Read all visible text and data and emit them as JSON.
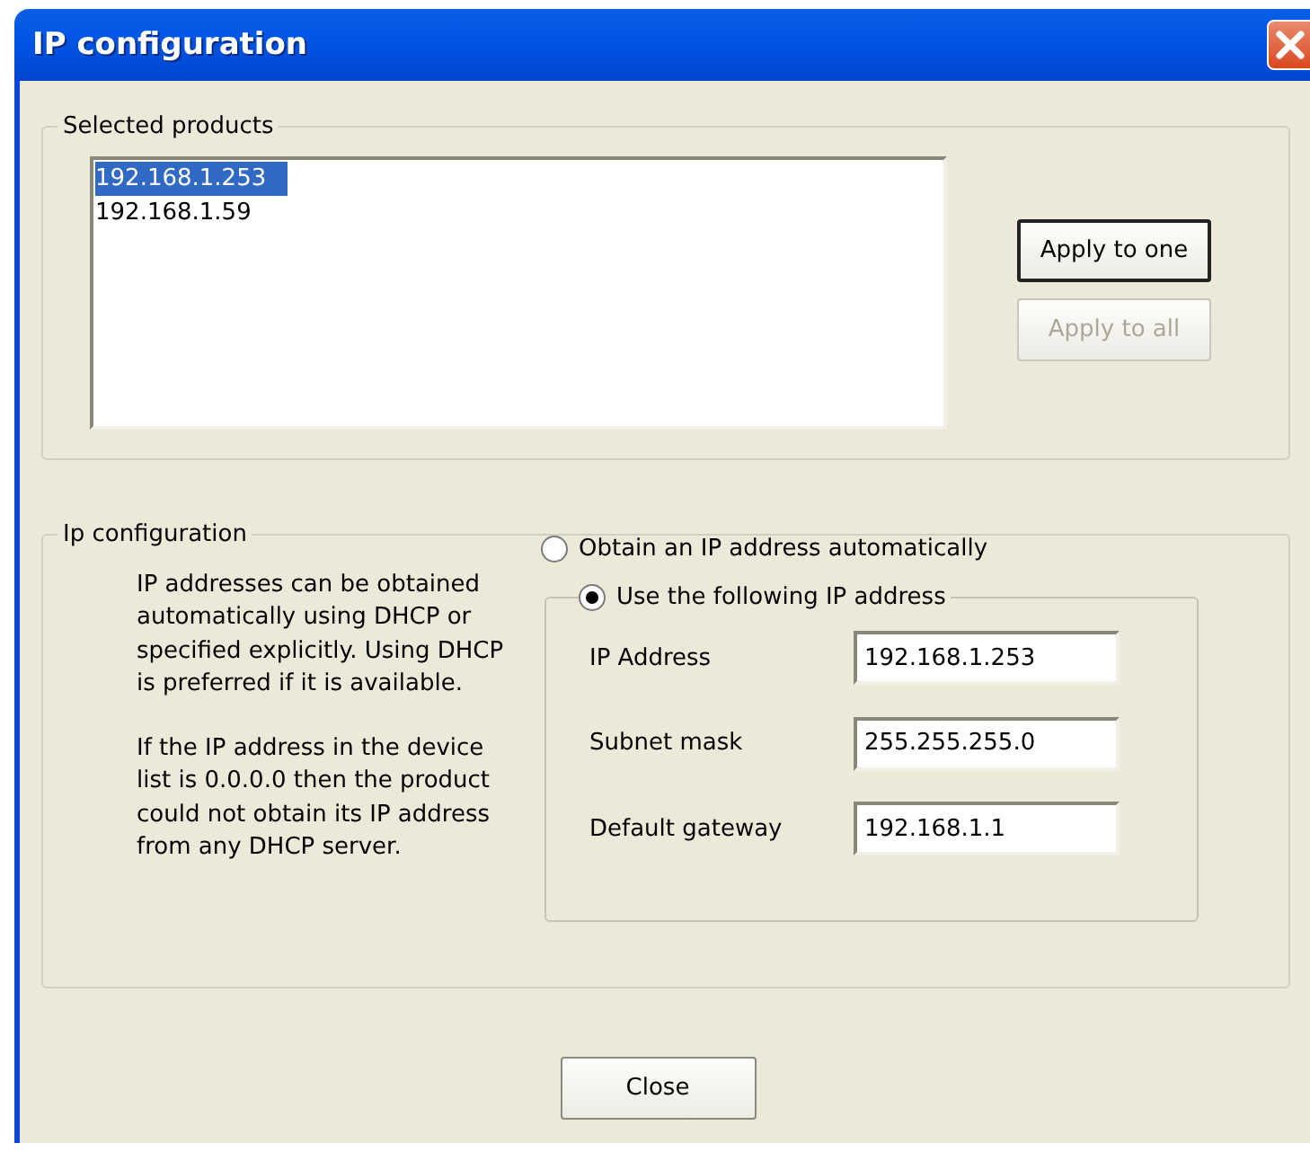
{
  "window": {
    "title": "IP configuration"
  },
  "selected_products": {
    "label": "Selected products",
    "items": [
      {
        "text": "192.168.1.253",
        "selected": true
      },
      {
        "text": "192.168.1.59",
        "selected": false
      }
    ],
    "buttons": [
      {
        "label": "Apply to one",
        "disabled": false,
        "default": true
      },
      {
        "label": "Apply to all",
        "disabled": true,
        "default": false
      }
    ]
  },
  "ip_configuration": {
    "label": "Ip configuration",
    "description": [
      "IP addresses can be obtained automatically using DHCP or specified explicitly. Using DHCP is preferred if it is available.",
      "If the IP address in the device list is 0.0.0.0 then the product could not obtain its IP address from any DHCP server."
    ],
    "options": [
      {
        "label": "Obtain an IP address automatically",
        "selected": false
      },
      {
        "label": "Use the following IP address",
        "selected": true
      }
    ],
    "fields": [
      {
        "label": "IP Address",
        "value": "192.168.1.253"
      },
      {
        "label": "Subnet mask",
        "value": "255.255.255.0"
      },
      {
        "label": "Default gateway",
        "value": "192.168.1.1"
      }
    ]
  },
  "close_button": "Close"
}
